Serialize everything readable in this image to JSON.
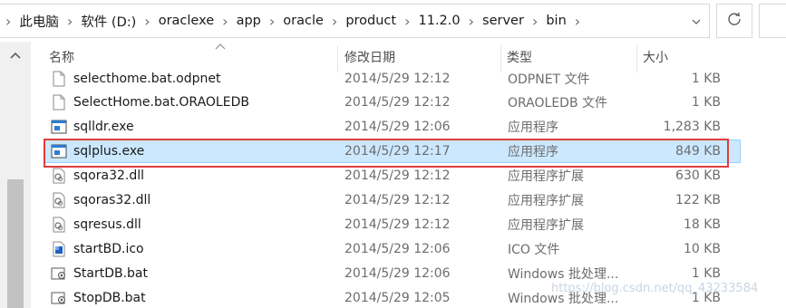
{
  "address_bar": {
    "breadcrumbs": [
      "此电脑",
      "软件 (D:)",
      "oraclexe",
      "app",
      "oracle",
      "product",
      "11.2.0",
      "server",
      "bin"
    ]
  },
  "columns": {
    "name": "名称",
    "date": "修改日期",
    "type": "类型",
    "size": "大小"
  },
  "files": [
    {
      "name": "selecthome.bat.odpnet",
      "date": "2014/5/29 12:12",
      "type": "ODPNET 文件",
      "size": "1 KB",
      "icon": "blank-file-icon"
    },
    {
      "name": "SelectHome.bat.ORAOLEDB",
      "date": "2014/5/29 12:12",
      "type": "ORAOLEDB 文件",
      "size": "1 KB",
      "icon": "blank-file-icon"
    },
    {
      "name": "sqlldr.exe",
      "date": "2014/5/29 12:06",
      "type": "应用程序",
      "size": "1,283 KB",
      "icon": "exe-icon"
    },
    {
      "name": "sqlplus.exe",
      "date": "2014/5/29 12:17",
      "type": "应用程序",
      "size": "849 KB",
      "icon": "exe-icon",
      "selected": true
    },
    {
      "name": "sqora32.dll",
      "date": "2014/5/29 12:12",
      "type": "应用程序扩展",
      "size": "630 KB",
      "icon": "dll-icon"
    },
    {
      "name": "sqoras32.dll",
      "date": "2014/5/29 12:12",
      "type": "应用程序扩展",
      "size": "122 KB",
      "icon": "dll-icon"
    },
    {
      "name": "sqresus.dll",
      "date": "2014/5/29 12:12",
      "type": "应用程序扩展",
      "size": "18 KB",
      "icon": "dll-icon"
    },
    {
      "name": "startBD.ico",
      "date": "2014/5/29 12:06",
      "type": "ICO 文件",
      "size": "10 KB",
      "icon": "ico-icon"
    },
    {
      "name": "StartDB.bat",
      "date": "2014/5/29 12:06",
      "type": "Windows 批处理...",
      "size": "1 KB",
      "icon": "bat-icon"
    },
    {
      "name": "StopDB.bat",
      "date": "2014/5/29 12:05",
      "type": "Windows 批处理...",
      "size": "1 KB",
      "icon": "bat-icon"
    }
  ],
  "watermark": "https://blog.csdn.net/qq_43233584",
  "colors": {
    "selected_bg": "#cce8ff",
    "selected_border": "#99d1ff",
    "highlight_outline": "#e03c3c"
  }
}
